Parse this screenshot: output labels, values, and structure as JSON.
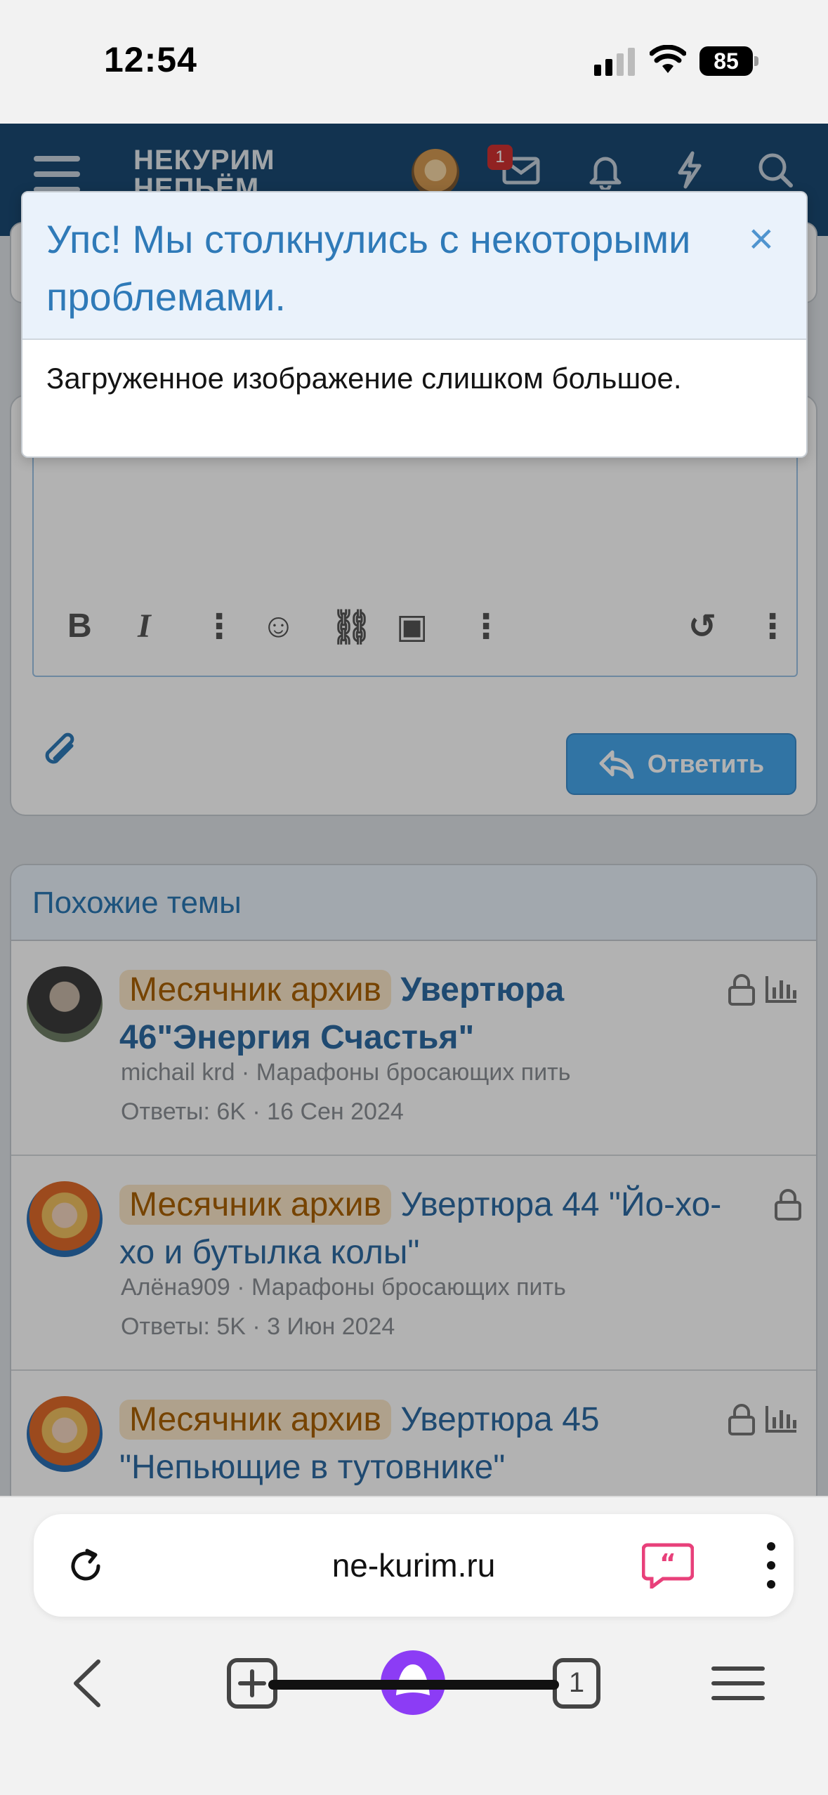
{
  "status": {
    "time": "12:54",
    "battery": "85"
  },
  "header": {
    "logo_line1": "НЕКУРИМ",
    "logo_line2": "НЕПЬЁМ",
    "notification_count": "1"
  },
  "editor": {
    "reply_label": "Ответить"
  },
  "similar": {
    "heading": "Похожие темы",
    "threads": [
      {
        "prefix": "Месячник архив",
        "title": "Увертюра 46\"Энергия Счастья\"",
        "author_forum": "michail krd · Марафоны бросающих пить",
        "stats": "Ответы: 6K · 16 Сен 2024"
      },
      {
        "prefix": "Месячник архив",
        "title": "Увертюра 44 \"Йо-хо-хо и бутылка колы\"",
        "author_forum": "Алёна909 · Марафоны бросающих пить",
        "stats": "Ответы: 5K · 3 Июн 2024"
      },
      {
        "prefix": "Месячник архив",
        "title": "Увертюра 45 \"Непьющие в тутовнике\"",
        "author_forum": "",
        "stats": ""
      }
    ]
  },
  "dialog": {
    "title": "Упс! Мы столкнулись с некоторыми проблемами.",
    "message": "Загруженное изображение слишком большое.",
    "close_symbol": "×"
  },
  "browser": {
    "url": "ne-kurim.ru",
    "tab_count": "1"
  },
  "colors": {
    "header_bg": "#1b4a73",
    "accent": "#2f7ab8",
    "prefix_bg": "#fbe7c9",
    "button": "#47a7eb"
  }
}
